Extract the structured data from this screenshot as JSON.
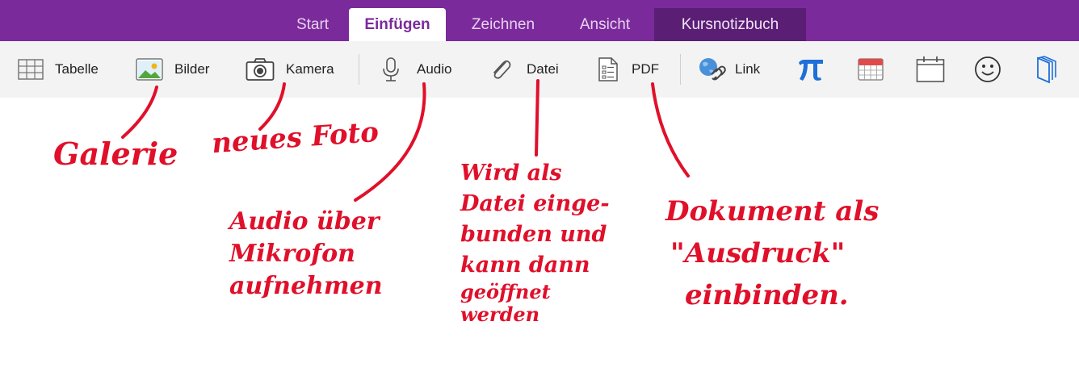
{
  "tabs": [
    {
      "label": "Start"
    },
    {
      "label": "Einfügen",
      "active": true
    },
    {
      "label": "Zeichnen"
    },
    {
      "label": "Ansicht"
    },
    {
      "label": "Kursnotizbuch"
    }
  ],
  "toolbar": {
    "table_label": "Tabelle",
    "pictures_label": "Bilder",
    "camera_label": "Kamera",
    "audio_label": "Audio",
    "file_label": "Datei",
    "pdf_label": "PDF",
    "link_label": "Link",
    "icons": [
      "table-icon",
      "picture-icon",
      "camera-icon",
      "microphone-icon",
      "paperclip-icon",
      "pdf-icon",
      "link-icon",
      "pi-icon",
      "calendar-icon",
      "date-icon",
      "smiley-icon",
      "notebook-icon"
    ]
  },
  "annotations": {
    "galerie": "Galerie",
    "neues_foto": "neues Foto",
    "audio": [
      "Audio über",
      "Mikrofon",
      "aufnehmen"
    ],
    "datei": [
      "Wird als",
      "Datei einge-",
      "bunden und",
      "kann dann",
      "geöffnet",
      "werden"
    ],
    "pdf": [
      "Dokument als",
      "\"Ausdruck\"",
      "einbinden."
    ]
  },
  "colors": {
    "tab_bar": "#7b2a9c",
    "tab_dark": "#5a1e74",
    "annotation": "#e0102a",
    "ribbon": "#f3f3f3",
    "accent_blue": "#1e6fd9"
  }
}
